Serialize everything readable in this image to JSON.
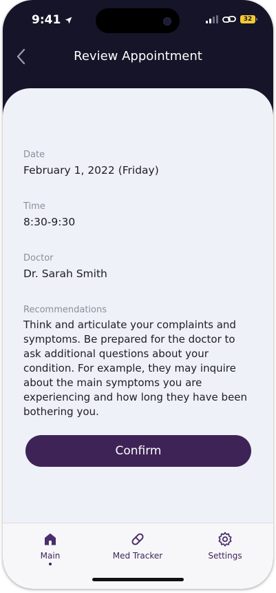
{
  "status_bar": {
    "time": "9:41",
    "battery": "32",
    "icons": [
      "location-arrow-icon",
      "signal-icon",
      "link-icon",
      "battery-icon"
    ]
  },
  "header": {
    "title": "Review Appointment",
    "back_icon": "chevron-left-icon"
  },
  "appointment": {
    "date_label": "Date",
    "date_value": "February 1, 2022 (Friday)",
    "time_label": "Time",
    "time_value": "8:30-9:30",
    "doctor_label": "Doctor",
    "doctor_value": "Dr. Sarah Smith",
    "recommendations_label": "Recommendations",
    "recommendations_value": "Think and articulate your complaints and symptoms. Be prepared for the doctor to ask additional questions about your condition. For example, they may inquire about the main symptoms you are experiencing and how long they have been bothering you."
  },
  "confirm_button": {
    "label": "Confirm"
  },
  "tab_bar": {
    "items": [
      {
        "label": "Main",
        "icon": "home-icon",
        "active": true
      },
      {
        "label": "Med Tracker",
        "icon": "pill-icon",
        "active": false
      },
      {
        "label": "Settings",
        "icon": "gear-icon",
        "active": false
      }
    ]
  },
  "colors": {
    "header_bg": "#151428",
    "sheet_bg": "#eef1f7",
    "accent": "#3e2456",
    "battery": "#f5c932"
  }
}
